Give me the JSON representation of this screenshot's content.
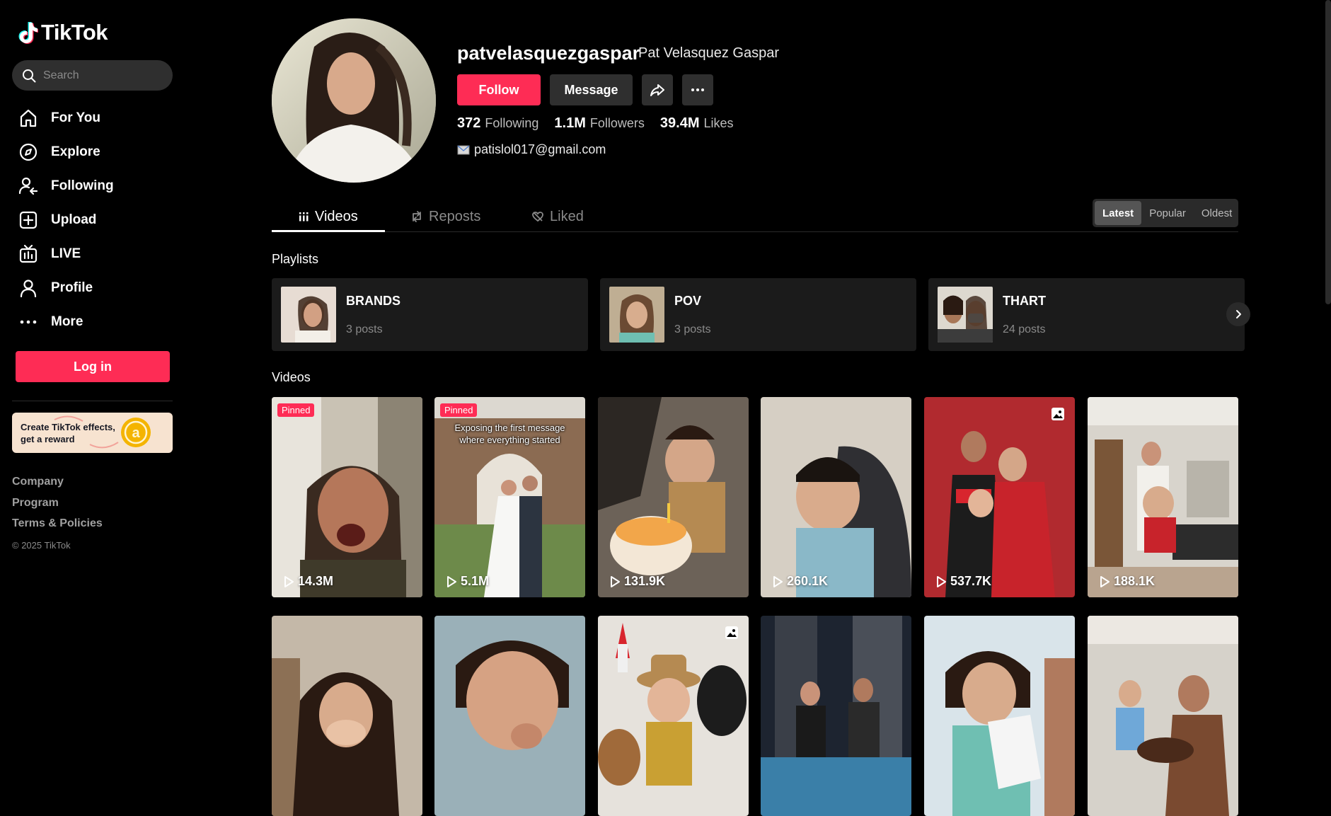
{
  "app": {
    "name": "TikTok"
  },
  "search": {
    "placeholder": "Search"
  },
  "nav": [
    {
      "label": "For You",
      "icon": "home-icon"
    },
    {
      "label": "Explore",
      "icon": "compass-icon"
    },
    {
      "label": "Following",
      "icon": "following-icon"
    },
    {
      "label": "Upload",
      "icon": "upload-icon"
    },
    {
      "label": "LIVE",
      "icon": "live-icon"
    },
    {
      "label": "Profile",
      "icon": "profile-icon"
    },
    {
      "label": "More",
      "icon": "more-icon"
    }
  ],
  "login_label": "Log in",
  "effects_banner": {
    "text": "Create TikTok effects, get a reward"
  },
  "footer": {
    "links": [
      "Company",
      "Program",
      "Terms & Policies"
    ],
    "copyright": "© 2025 TikTok"
  },
  "profile": {
    "username": "patvelasquezgaspar",
    "display_name": "Pat Velasquez Gaspar",
    "follow_label": "Follow",
    "message_label": "Message",
    "stats": [
      {
        "value": "372",
        "label": "Following"
      },
      {
        "value": "1.1M",
        "label": "Followers"
      },
      {
        "value": "39.4M",
        "label": "Likes"
      }
    ],
    "bio": "patislol017@gmail.com"
  },
  "tabs": [
    "Videos",
    "Reposts",
    "Liked"
  ],
  "sort": [
    "Latest",
    "Popular",
    "Oldest"
  ],
  "playlists_title": "Playlists",
  "playlists": [
    {
      "name": "BRANDS",
      "count": "3 posts"
    },
    {
      "name": "POV",
      "count": "3 posts"
    },
    {
      "name": "THART",
      "count": "24 posts"
    }
  ],
  "videos_title": "Videos",
  "videos": [
    {
      "views": "14.3M",
      "badge": "Pinned",
      "caption": ""
    },
    {
      "views": "5.1M",
      "badge": "Pinned",
      "caption": "Exposing the first message where everything started"
    },
    {
      "views": "131.9K",
      "badge": "",
      "caption": ""
    },
    {
      "views": "260.1K",
      "badge": "",
      "caption": ""
    },
    {
      "views": "537.7K",
      "badge": "",
      "caption": ""
    },
    {
      "views": "188.1K",
      "badge": "",
      "caption": ""
    },
    {
      "views": "",
      "badge": "",
      "caption": ""
    },
    {
      "views": "",
      "badge": "",
      "caption": ""
    },
    {
      "views": "",
      "badge": "",
      "caption": ""
    },
    {
      "views": "",
      "badge": "",
      "caption": ""
    },
    {
      "views": "",
      "badge": "",
      "caption": ""
    },
    {
      "views": "",
      "badge": "",
      "caption": ""
    }
  ],
  "colors": {
    "accent": "#fe2c55",
    "background": "#000000",
    "surface": "#1b1b1b"
  }
}
